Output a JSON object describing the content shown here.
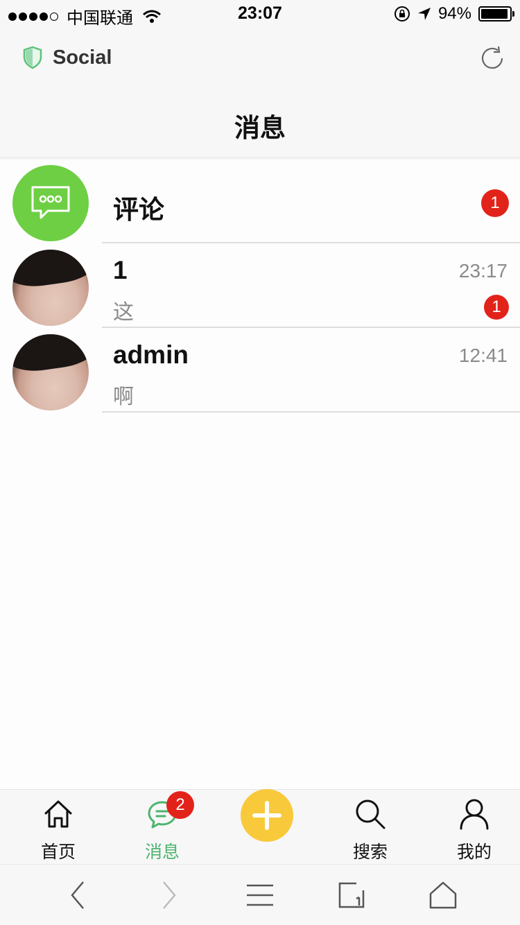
{
  "status_bar": {
    "carrier": "中国联通",
    "time": "23:07",
    "battery": "94%",
    "battery_level": 0.94,
    "icons": [
      "signal-dots",
      "wifi-icon",
      "rotation-lock-icon",
      "location-arrow-icon",
      "battery-icon"
    ]
  },
  "header": {
    "brand": "Social",
    "title": "消息",
    "icons": [
      "shield-icon",
      "refresh-icon"
    ]
  },
  "messages": [
    {
      "title": "评论",
      "preview": "",
      "time": "",
      "badge": "1",
      "avatar": "comment-icon"
    },
    {
      "title": "1",
      "preview": "这",
      "time": "23:17",
      "badge": "1",
      "avatar": "user-photo"
    },
    {
      "title": "admin",
      "preview": "啊",
      "time": "12:41",
      "badge": "",
      "avatar": "user-photo"
    }
  ],
  "tab_bar": {
    "tabs": [
      {
        "label": "首页",
        "icon": "home-icon"
      },
      {
        "label": "消息",
        "icon": "chat-icon",
        "badge": "2",
        "active": true
      },
      {
        "label": "",
        "icon": "plus-icon"
      },
      {
        "label": "搜索",
        "icon": "search-icon"
      },
      {
        "label": "我的",
        "icon": "user-icon"
      }
    ]
  },
  "browser_toolbar": {
    "icons": [
      "back-icon",
      "forward-icon",
      "menu-icon",
      "tabs-icon",
      "home-icon"
    ]
  },
  "colors": {
    "accent_green": "#4cb46e",
    "avatar_green": "#6ecf44",
    "badge_red": "#e2231a",
    "add_yellow": "#f8c93b"
  }
}
